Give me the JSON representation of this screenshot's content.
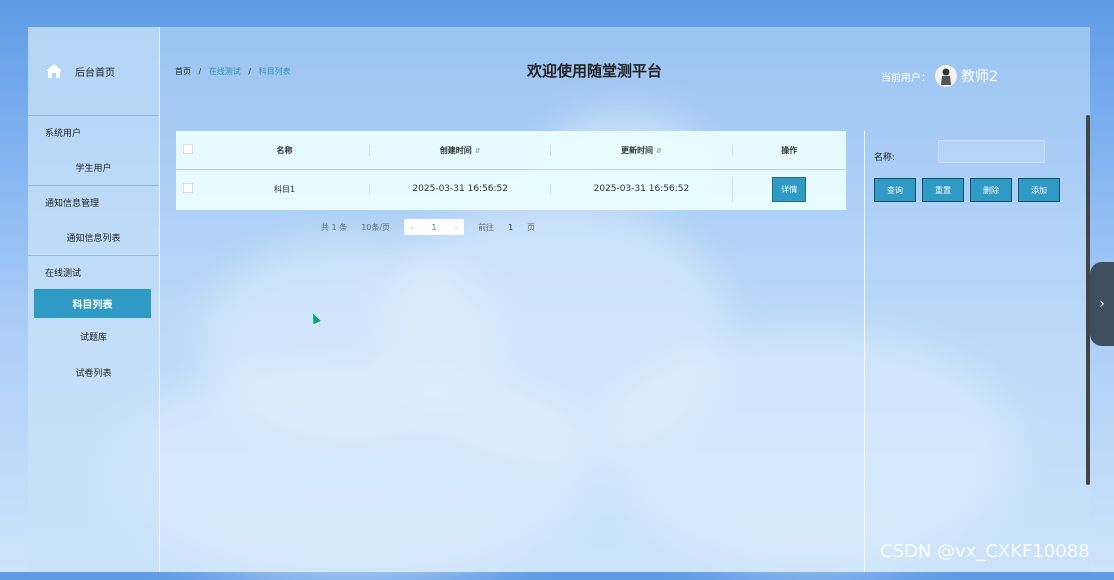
{
  "sidebar": {
    "home_label": "后台首页",
    "groups": [
      {
        "title": "系统用户",
        "items": [
          "学生用户"
        ]
      },
      {
        "title": "通知信息管理",
        "items": [
          "通知信息列表"
        ]
      },
      {
        "title": "在线测试",
        "items": [
          "科目列表",
          "试题库",
          "试卷列表"
        ]
      }
    ],
    "active_item": "科目列表"
  },
  "breadcrumb": {
    "home": "首页",
    "sep": "/",
    "level1": "在线测试",
    "level2": "科目列表"
  },
  "header": {
    "title": "欢迎使用随堂测平台",
    "user_label": "当前用户：",
    "user_name": "教师2"
  },
  "table": {
    "columns": [
      "名称",
      "创建时间",
      "更新时间",
      "操作"
    ],
    "rows": [
      {
        "name": "科目1",
        "created": "2025-03-31 16:56:52",
        "updated": "2025-03-31 16:56:52",
        "action": "详情"
      }
    ]
  },
  "pager": {
    "total": "共 1 条",
    "page_size": "10条/页",
    "current": "1",
    "goto_label": "前往",
    "goto_value": "1",
    "page_unit": "页"
  },
  "search": {
    "label": "名称:",
    "value": "",
    "buttons": {
      "query": "查询",
      "reset": "重置",
      "delete": "删除",
      "add": "添加"
    }
  },
  "watermark": "CSDN @vx_CXKF10088",
  "colors": {
    "accent": "#2f9bc4",
    "link": "#2f8fb5"
  }
}
